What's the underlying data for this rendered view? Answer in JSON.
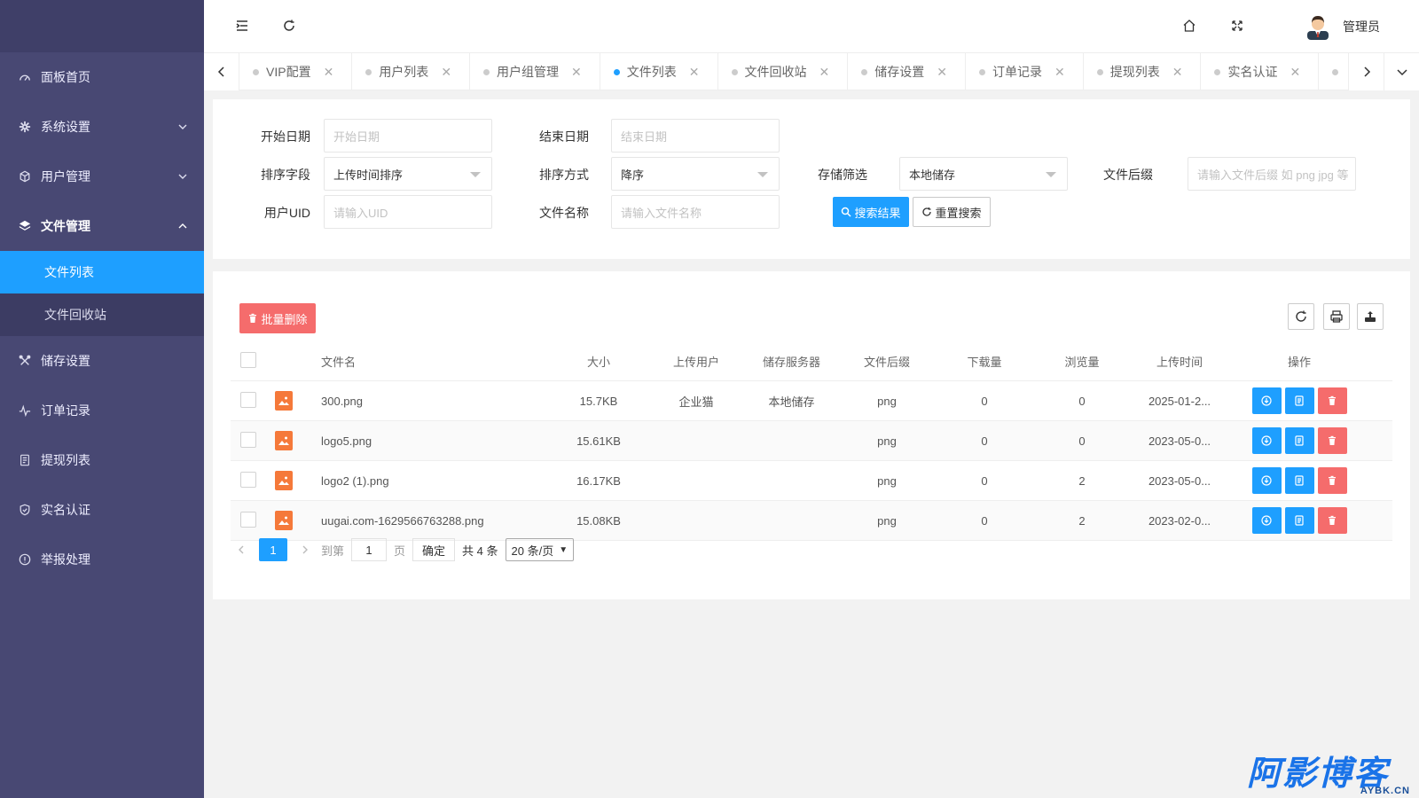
{
  "sidebar": {
    "items": [
      {
        "label": "面板首页",
        "icon": "dashboard-icon"
      },
      {
        "label": "系统设置",
        "icon": "gear-icon"
      },
      {
        "label": "用户管理",
        "icon": "cube-icon"
      },
      {
        "label": "文件管理",
        "icon": "layers-icon"
      },
      {
        "label": "储存设置",
        "icon": "tools-icon"
      },
      {
        "label": "订单记录",
        "icon": "pulse-icon"
      },
      {
        "label": "提现列表",
        "icon": "list-icon"
      },
      {
        "label": "实名认证",
        "icon": "shield-icon"
      },
      {
        "label": "举报处理",
        "icon": "info-icon"
      }
    ],
    "file_submenu": [
      {
        "label": "文件列表",
        "active": true
      },
      {
        "label": "文件回收站",
        "active": false
      }
    ]
  },
  "header": {
    "user_name": "管理员"
  },
  "tabs": [
    {
      "label": "VIP配置",
      "active": false
    },
    {
      "label": "用户列表",
      "active": false
    },
    {
      "label": "用户组管理",
      "active": false
    },
    {
      "label": "文件列表",
      "active": true
    },
    {
      "label": "文件回收站",
      "active": false
    },
    {
      "label": "储存设置",
      "active": false
    },
    {
      "label": "订单记录",
      "active": false
    },
    {
      "label": "提现列表",
      "active": false
    },
    {
      "label": "实名认证",
      "active": false
    }
  ],
  "search": {
    "start_date_label": "开始日期",
    "start_date_placeholder": "开始日期",
    "end_date_label": "结束日期",
    "end_date_placeholder": "结束日期",
    "sort_field_label": "排序字段",
    "sort_field_value": "上传时间排序",
    "sort_order_label": "排序方式",
    "sort_order_value": "降序",
    "storage_label": "存储筛选",
    "storage_value": "本地储存",
    "ext_label": "文件后缀",
    "ext_placeholder": "请输入文件后缀 如 png jpg 等",
    "uid_label": "用户UID",
    "uid_placeholder": "请输入UID",
    "name_label": "文件名称",
    "name_placeholder": "请输入文件名称",
    "search_button": "搜索结果",
    "reset_button": "重置搜索"
  },
  "table": {
    "batch_delete": "批量删除",
    "columns": {
      "name": "文件名",
      "size": "大小",
      "user": "上传用户",
      "server": "储存服务器",
      "ext": "文件后缀",
      "downloads": "下载量",
      "views": "浏览量",
      "time": "上传时间",
      "actions": "操作"
    },
    "rows": [
      {
        "name": "300.png",
        "size": "15.7KB",
        "user": "企业猫",
        "server": "本地储存",
        "ext": "png",
        "downloads": "0",
        "views": "0",
        "time": "2025-01-2..."
      },
      {
        "name": "logo5.png",
        "size": "15.61KB",
        "user": "",
        "server": "",
        "ext": "png",
        "downloads": "0",
        "views": "0",
        "time": "2023-05-0..."
      },
      {
        "name": "logo2 (1).png",
        "size": "16.17KB",
        "user": "",
        "server": "",
        "ext": "png",
        "downloads": "0",
        "views": "2",
        "time": "2023-05-0..."
      },
      {
        "name": "uugai.com-1629566763288.png",
        "size": "15.08KB",
        "user": "",
        "server": "",
        "ext": "png",
        "downloads": "0",
        "views": "2",
        "time": "2023-02-0..."
      }
    ]
  },
  "pager": {
    "current": "1",
    "goto_label": "到第",
    "goto_value": "1",
    "page_label": "页",
    "confirm": "确定",
    "total": "共 4 条",
    "per_page": "20 条/页"
  },
  "watermark": {
    "main": "阿影博客",
    "sub": "AYBK.CN"
  },
  "colors": {
    "sidebar_bg": "#484873",
    "accent": "#1e9fff",
    "danger": "#f56c6c",
    "file_icon": "#f5793a"
  }
}
